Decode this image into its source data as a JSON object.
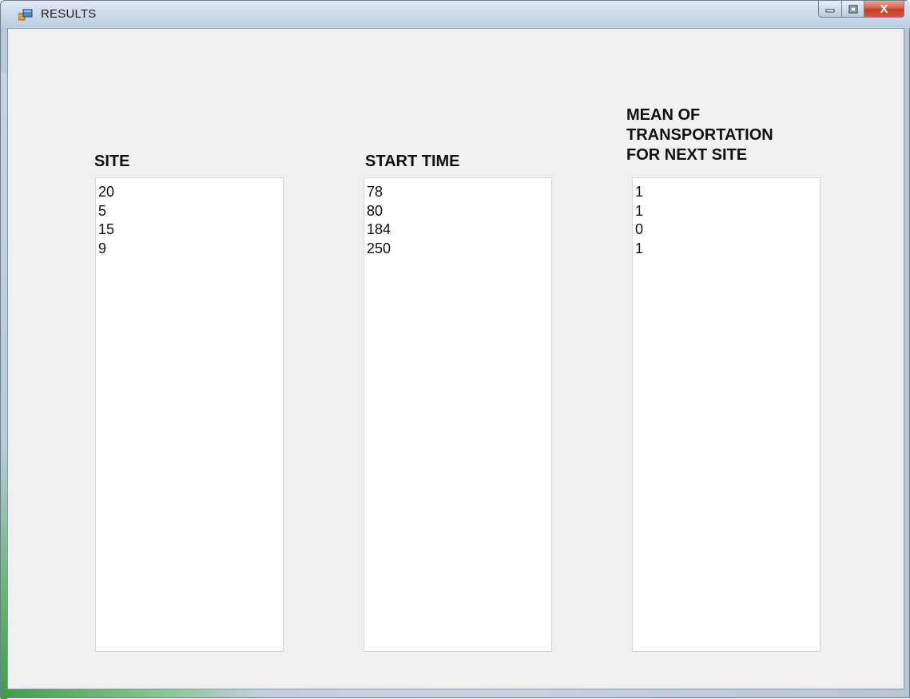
{
  "window": {
    "title": "RESULTS",
    "controls": {
      "minimize_icon": "minimize-icon",
      "maximize_icon": "maximize-icon",
      "close_icon": "close-icon",
      "close_glyph": "X"
    }
  },
  "columns": [
    {
      "label": "SITE",
      "values": [
        "20",
        "5",
        "15",
        "9"
      ]
    },
    {
      "label": "START TIME",
      "values": [
        "78",
        "80",
        "184",
        "250"
      ]
    },
    {
      "label_lines": [
        "MEAN OF",
        "TRANSPORTATION",
        "FOR NEXT SITE"
      ],
      "values": [
        "1",
        "1",
        "0",
        "1"
      ]
    }
  ],
  "colors": {
    "client_background": "#f0f0f0",
    "list_background": "#ffffff",
    "close_button": "#c13c25"
  }
}
